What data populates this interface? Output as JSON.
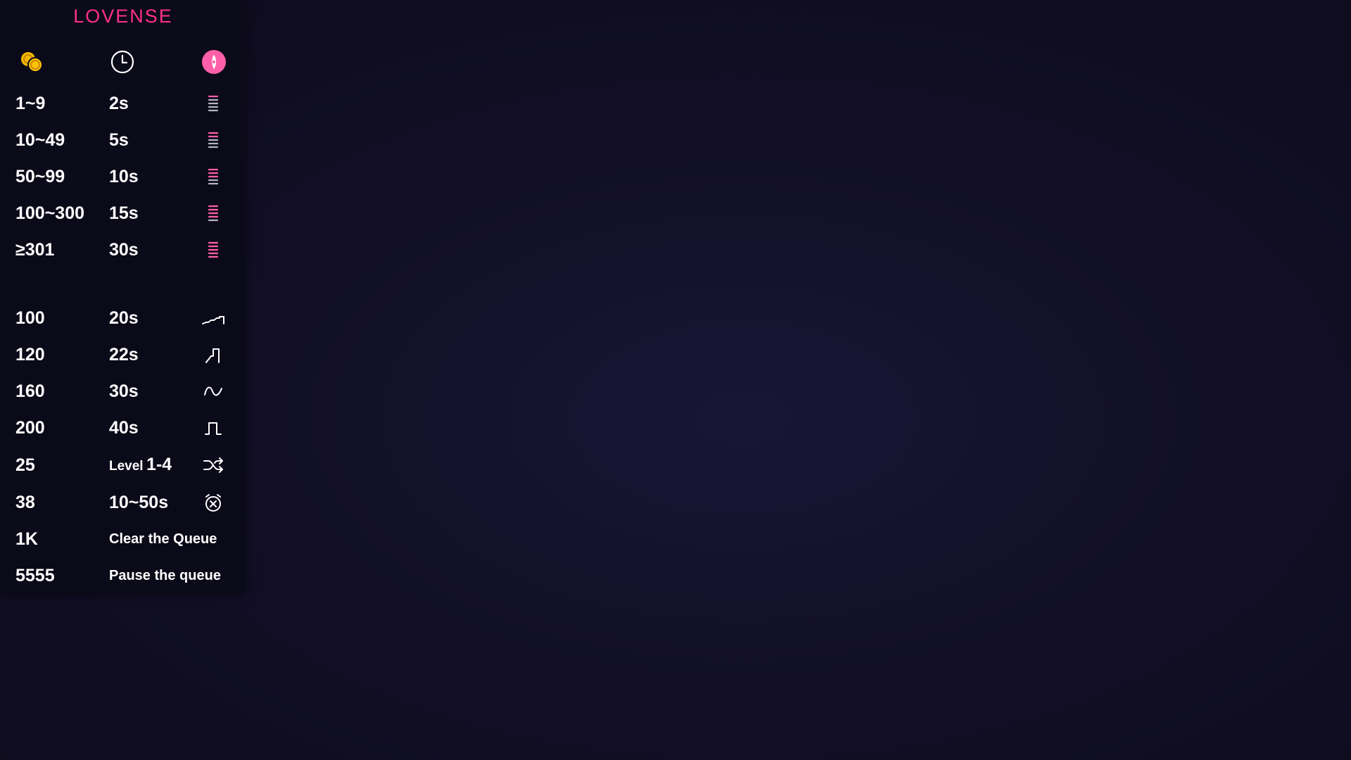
{
  "brand": {
    "name": "LOVENSE",
    "color": "#ff2f8c"
  },
  "header": {
    "icons": [
      "coins-icon",
      "clock-icon",
      "toy-icon"
    ]
  },
  "levels": [
    {
      "tokens": "1~9",
      "duration": "2s",
      "icon": "vibration-low-icon"
    },
    {
      "tokens": "10~49",
      "duration": "5s",
      "icon": "vibration-low-medium-icon"
    },
    {
      "tokens": "50~99",
      "duration": "10s",
      "icon": "vibration-medium-icon"
    },
    {
      "tokens": "100~300",
      "duration": "15s",
      "icon": "vibration-high-icon"
    },
    {
      "tokens": "≥301",
      "duration": "30s",
      "icon": "vibration-ultra-icon"
    }
  ],
  "specials": [
    {
      "tokens": "100",
      "duration": "20s",
      "icon": "pattern-wave-steps-icon"
    },
    {
      "tokens": "120",
      "duration": "22s",
      "icon": "pattern-fireworks-icon"
    },
    {
      "tokens": "160",
      "duration": "30s",
      "icon": "pattern-wave-icon"
    },
    {
      "tokens": "200",
      "duration": "40s",
      "icon": "pattern-pulse-icon"
    },
    {
      "tokens": "25",
      "level_word": "Level",
      "level_range": "1-4",
      "icon": "random-shuffle-icon"
    },
    {
      "tokens": "38",
      "duration": "10~50s",
      "icon": "random-time-alarm-icon"
    },
    {
      "tokens": "1K",
      "text": "Clear the Queue"
    },
    {
      "tokens": "5555",
      "text": "Pause the queue"
    }
  ],
  "colors": {
    "accent": "#ff2f8c",
    "coin": "#f5b800",
    "panel": "#0b0a19",
    "text": "#ffffff"
  }
}
